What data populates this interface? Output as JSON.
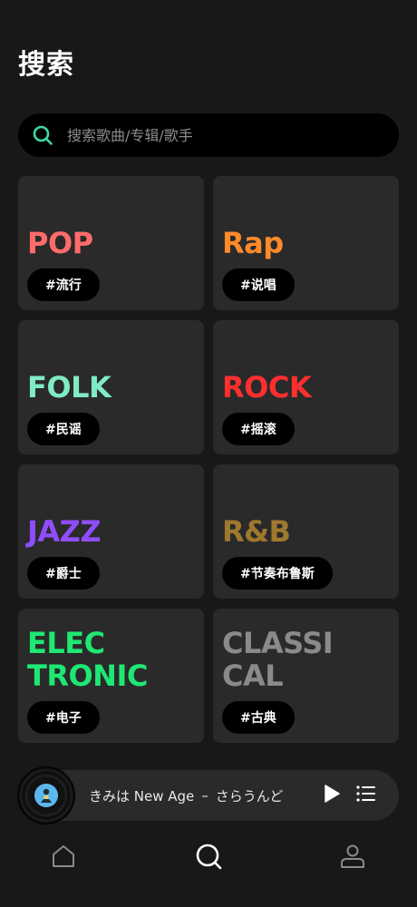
{
  "header": {
    "title": "搜索"
  },
  "search": {
    "placeholder": "搜索歌曲/专辑/歌手",
    "value": "",
    "icon": "search-icon",
    "icon_color": "#3dd9a6"
  },
  "genres": [
    {
      "id": "pop",
      "title": "POP",
      "tag": "#流行",
      "color": "#ff6b6b"
    },
    {
      "id": "rap",
      "title": "Rap",
      "tag": "#说唱",
      "color": "#ff8a2a"
    },
    {
      "id": "folk",
      "title": "FOLK",
      "tag": "#民谣",
      "color": "#7fecc3"
    },
    {
      "id": "rock",
      "title": "ROCK",
      "tag": "#摇滚",
      "color": "#ff2f2f"
    },
    {
      "id": "jazz",
      "title": "JAZZ",
      "tag": "#爵士",
      "color": "#8f4dff"
    },
    {
      "id": "rnb",
      "title": "R&B",
      "tag": "#节奏布鲁斯",
      "color": "#a0782e"
    },
    {
      "id": "electronic",
      "title": "ELEC\nTRONIC",
      "tag": "#电子",
      "color": "#1ee873"
    },
    {
      "id": "classical",
      "title": "CLASSI\nCAL",
      "tag": "#古典",
      "color": "#8a8a8a"
    }
  ],
  "player": {
    "song": "きみは New Age",
    "separator": "–",
    "artist": "さらうんど",
    "play_icon": "play-icon",
    "playlist_icon": "playlist-icon"
  },
  "tabbar": {
    "items": [
      {
        "id": "home",
        "icon": "home-icon",
        "active": false
      },
      {
        "id": "search",
        "icon": "search-icon",
        "active": true
      },
      {
        "id": "profile",
        "icon": "user-icon",
        "active": false
      }
    ],
    "active_color": "#ffffff",
    "inactive_color": "#8a8a8a"
  }
}
